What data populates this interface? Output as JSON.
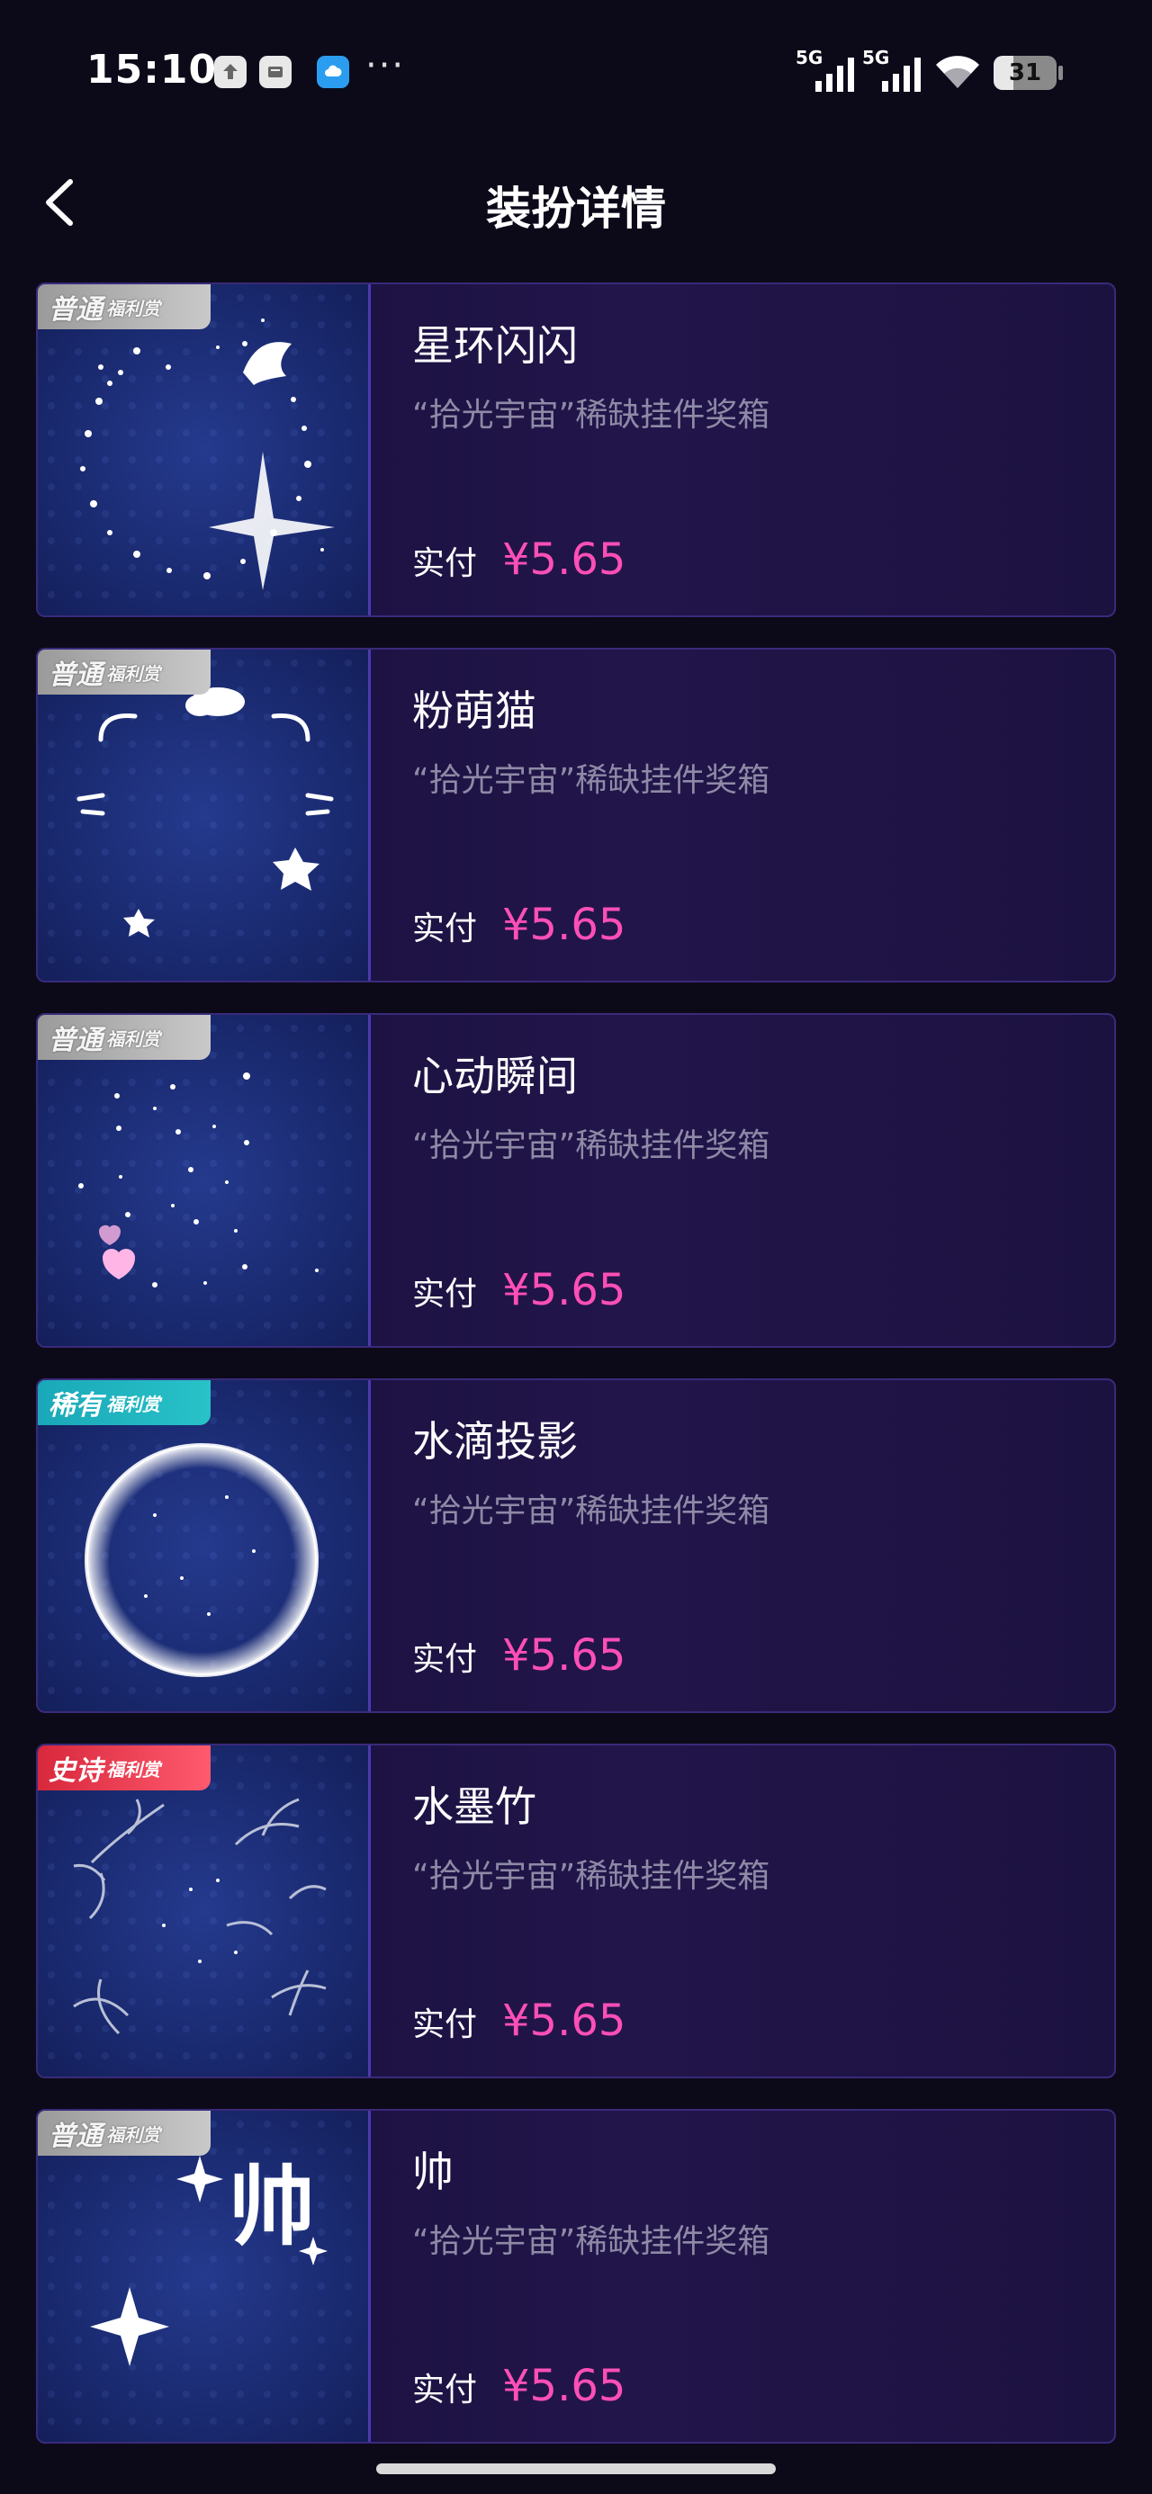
{
  "status_bar": {
    "time": "15:10",
    "network_1": "5G",
    "network_2": "5G",
    "battery": "31",
    "battery_level": 0.31,
    "more": "···"
  },
  "nav": {
    "title": "装扮详情",
    "back_icon": "chevron-left-icon"
  },
  "items": [
    {
      "badge_tier": "普通",
      "badge_sub": "福利赏",
      "badge_type": "normal",
      "name": "星环闪闪",
      "source": "“拾光宇宙”稀缺挂件奖箱",
      "price_label": "实付",
      "price": "¥5.65",
      "art": "star-ring"
    },
    {
      "badge_tier": "普通",
      "badge_sub": "福利赏",
      "badge_type": "normal",
      "name": "粉萌猫",
      "source": "“拾光宇宙”稀缺挂件奖箱",
      "price_label": "实付",
      "price": "¥5.65",
      "art": "cat-ears"
    },
    {
      "badge_tier": "普通",
      "badge_sub": "福利赏",
      "badge_type": "normal",
      "name": "心动瞬间",
      "source": "“拾光宇宙”稀缺挂件奖箱",
      "price_label": "实付",
      "price": "¥5.65",
      "art": "hearts-sparkle"
    },
    {
      "badge_tier": "稀有",
      "badge_sub": "福利赏",
      "badge_type": "rare",
      "name": "水滴投影",
      "source": "“拾光宇宙”稀缺挂件奖箱",
      "price_label": "实付",
      "price": "¥5.65",
      "art": "bubble-ring"
    },
    {
      "badge_tier": "史诗",
      "badge_sub": "福利赏",
      "badge_type": "epic",
      "name": "水墨竹",
      "source": "“拾光宇宙”稀缺挂件奖箱",
      "price_label": "实付",
      "price": "¥5.65",
      "art": "bamboo"
    },
    {
      "badge_tier": "普通",
      "badge_sub": "福利赏",
      "badge_type": "normal",
      "name": "帅",
      "source": "“拾光宇宙”稀缺挂件奖箱",
      "price_label": "实付",
      "price": "¥5.65",
      "art": "shuai-text",
      "art_text": "帅"
    }
  ],
  "colors": {
    "background": "#0c0a19",
    "price": "#ff4fb6",
    "card_border": "#3a2a7a",
    "rare_badge": "#1aa8b8",
    "epic_badge": "#d8283c",
    "normal_badge": "#b0b0b0"
  }
}
